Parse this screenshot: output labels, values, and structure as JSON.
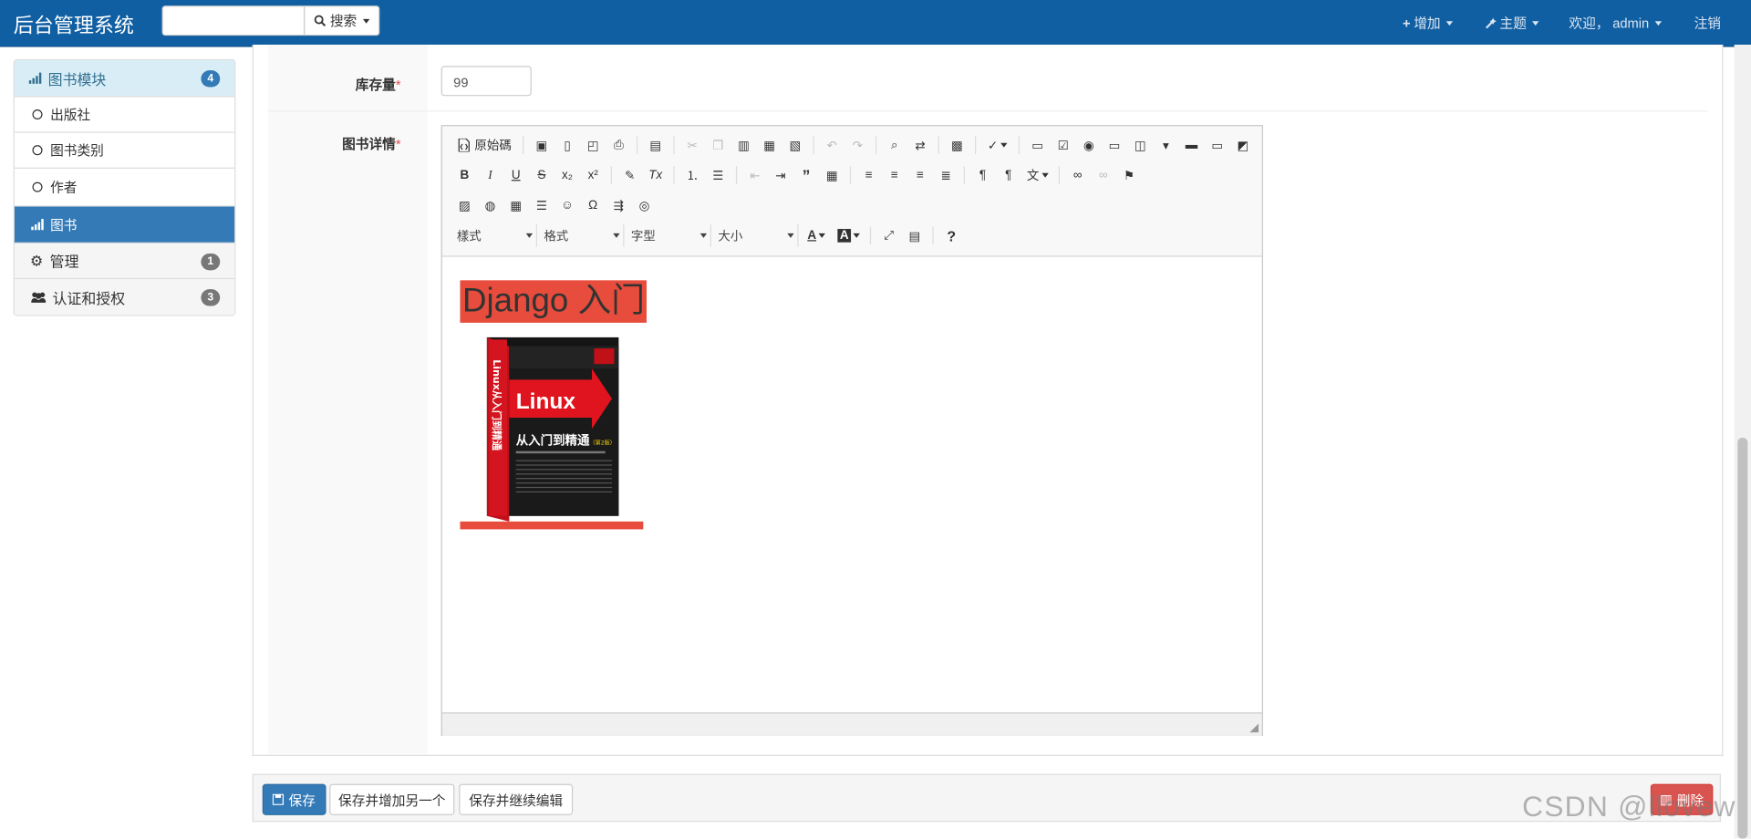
{
  "navbar": {
    "brand": "后台管理系统",
    "search_placeholder": "",
    "search_button": "搜索",
    "add_menu": "增加",
    "theme_menu": "主题",
    "welcome": "欢迎，",
    "username": "admin",
    "logout": "注销"
  },
  "sidebar": {
    "header": {
      "label": "图书模块",
      "badge": "4"
    },
    "items": [
      {
        "label": "出版社"
      },
      {
        "label": "图书类别"
      },
      {
        "label": "作者"
      },
      {
        "label": "图书"
      }
    ],
    "groups": [
      {
        "label": "管理",
        "badge": "1"
      },
      {
        "label": "认证和授权",
        "badge": "3"
      }
    ]
  },
  "form": {
    "stock_label": "库存量",
    "stock_value": "99",
    "detail_label": "图书详情",
    "required_mark": "*"
  },
  "editor": {
    "source_button": "原始碼",
    "combos": {
      "styles": "樣式",
      "format": "格式",
      "font": "字型",
      "size": "大小"
    },
    "content_heading": "Django 入门",
    "book_cover": {
      "title": "Linux",
      "subtitle": "从入门到精通",
      "edition": "（第2版）",
      "spine": "Linux从入门到精通"
    }
  },
  "actions": {
    "save": "保存",
    "save_add": "保存并增加另一个",
    "save_continue": "保存并继续编辑",
    "delete": "删除"
  },
  "watermark": "CSDN @llovew",
  "colors": {
    "navbar": "#115fa3",
    "primary": "#337ab7",
    "danger": "#d9534f",
    "highlight": "#e74c3c",
    "sidebar_header": "#d9edf7"
  }
}
